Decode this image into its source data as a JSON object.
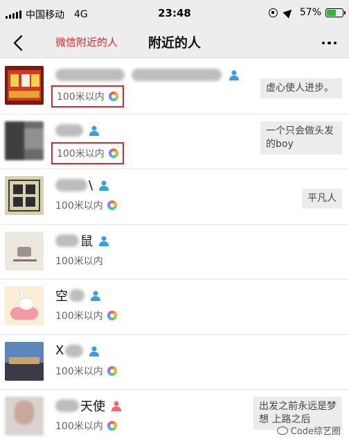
{
  "status_bar": {
    "carrier": "中国移动",
    "network": "4G",
    "time": "23:48",
    "battery_text": "57%",
    "battery_level": 0.57,
    "battery_color": "#2bb72b"
  },
  "nav": {
    "annotation": "微信附近的人",
    "title": "附近的人",
    "annotation_color": "#e0262a"
  },
  "people": [
    {
      "name_visible": "",
      "gender": "male",
      "distance": "100米以内",
      "signature": "虚心使人进步。",
      "highlighted": true
    },
    {
      "name_visible": "",
      "gender": "male",
      "distance": "100米以内",
      "signature": "一个只会做头发的boy",
      "highlighted": true
    },
    {
      "name_visible": "\\",
      "gender": "male",
      "distance": "100米以内",
      "signature": "平凡人",
      "highlighted": false
    },
    {
      "name_visible": "鼠",
      "gender": "male",
      "distance": "100米以内",
      "signature": "",
      "highlighted": false
    },
    {
      "name_visible": "空",
      "gender": "male",
      "distance": "100米以内",
      "signature": "",
      "highlighted": false
    },
    {
      "name_visible": "X",
      "gender": "male",
      "distance": "100米以内",
      "signature": "",
      "highlighted": false
    },
    {
      "name_visible": "天使",
      "gender": "female",
      "distance": "100米以内",
      "signature": "出发之前永远是梦想 上路之后",
      "highlighted": false
    }
  ],
  "watermark": "Code综艺圈",
  "icons": {
    "back": "chevron-left-icon",
    "more": "more-dots-icon",
    "male": "male-user-icon",
    "female": "female-user-icon",
    "moments": "moments-wheel-icon"
  },
  "colors": {
    "male": "#3a9fdc",
    "female": "#f06a6a",
    "highlight": "#e0262a"
  }
}
